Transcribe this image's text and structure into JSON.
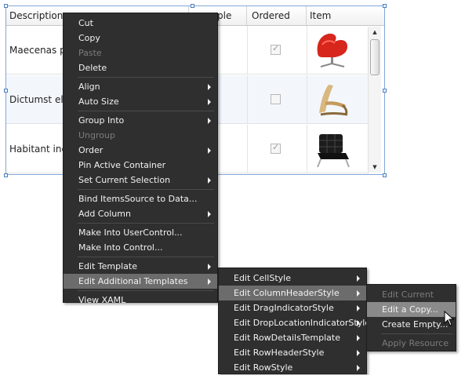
{
  "grid": {
    "columns": [
      "Description",
      "ple",
      "Ordered",
      "Item"
    ],
    "rows": [
      {
        "description": "Maecenas pr",
        "ordered": true,
        "item_icon": "red-swan-chair-icon"
      },
      {
        "description": "Dictumst ele",
        "ordered": false,
        "item_icon": "wooden-lounge-chair-icon"
      },
      {
        "description": "Habitant inc",
        "ordered": true,
        "item_icon": "black-leather-chair-icon"
      }
    ]
  },
  "context_menu": {
    "items": [
      "Cut",
      "Copy",
      "Paste",
      "Delete",
      "Align",
      "Auto Size",
      "Group Into",
      "Ungroup",
      "Order",
      "Pin Active Container",
      "Set Current Selection",
      "Bind ItemsSource to Data...",
      "Add Column",
      "Make Into UserControl...",
      "Make Into Control...",
      "Edit Template",
      "Edit Additional Templates",
      "View XAML"
    ]
  },
  "submenu_templates": {
    "items": [
      "Edit CellStyle",
      "Edit ColumnHeaderStyle",
      "Edit DragIndicatorStyle",
      "Edit DropLocationIndicatorStyle",
      "Edit RowDetailsTemplate",
      "Edit RowHeaderStyle",
      "Edit RowStyle"
    ]
  },
  "submenu_style": {
    "items": [
      "Edit Current",
      "Edit a Copy...",
      "Create Empty...",
      "Apply Resource"
    ]
  }
}
